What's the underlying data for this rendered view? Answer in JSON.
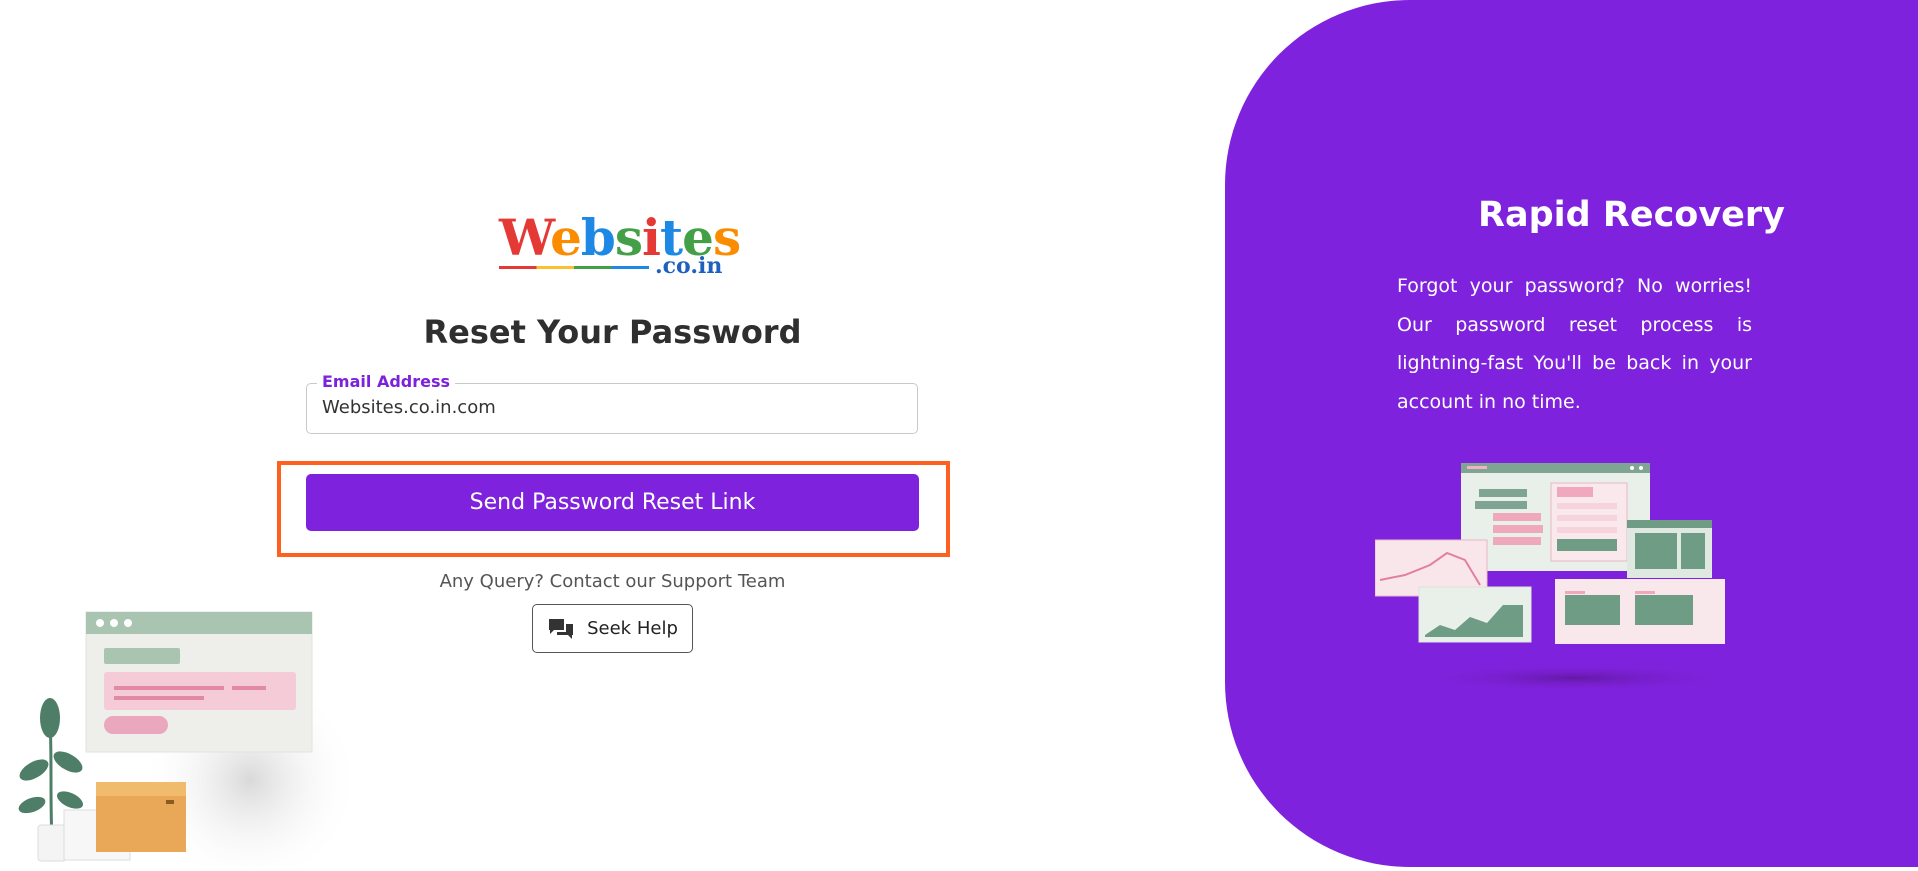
{
  "brand": {
    "logo_word": "Websites",
    "logo_suffix": ".co.in"
  },
  "form": {
    "title": "Reset Your Password",
    "email_label": "Email Address",
    "email_value": "Websites.co.in.com",
    "submit_label": "Send Password Reset Link",
    "support_text": "Any Query? Contact our Support Team",
    "help_label": "Seek Help"
  },
  "side_panel": {
    "title": "Rapid Recovery",
    "description": "Forgot your password? No worries! Our password reset process is lightning-fast You'll be back in your account in no time."
  },
  "icons": {
    "help": "chat-bubbles-icon"
  },
  "colors": {
    "accent": "#7f22dd",
    "highlight_border": "#ff5f1f"
  }
}
